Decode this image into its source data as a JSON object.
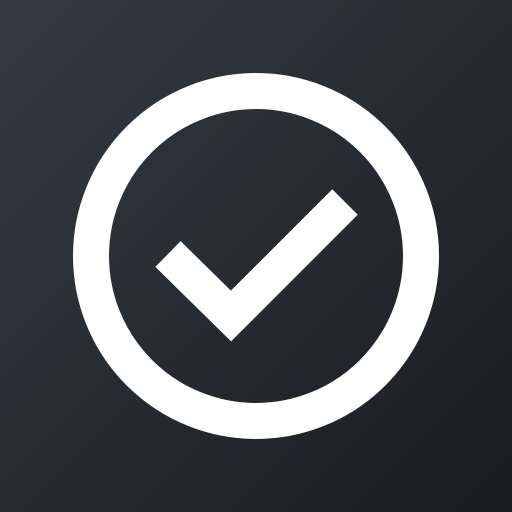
{
  "app_icon": {
    "icon": "check-circle-icon",
    "colors": {
      "background_top": "#353a43",
      "background_bottom": "#191c20",
      "foreground": "#ffffff"
    }
  }
}
